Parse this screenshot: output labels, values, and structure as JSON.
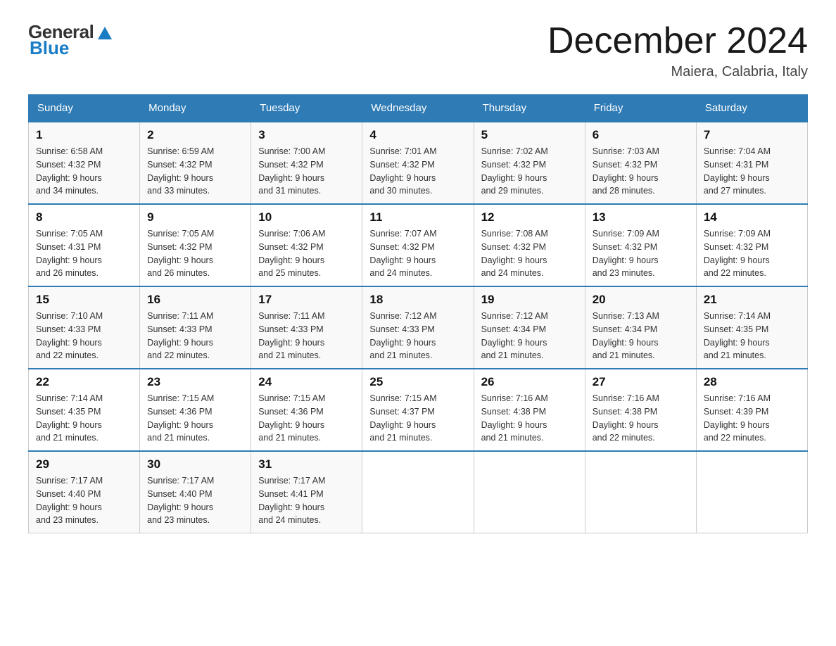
{
  "logo": {
    "text_general": "General",
    "text_blue": "Blue",
    "icon_shape": "triangle"
  },
  "title": "December 2024",
  "subtitle": "Maiera, Calabria, Italy",
  "days_of_week": [
    "Sunday",
    "Monday",
    "Tuesday",
    "Wednesday",
    "Thursday",
    "Friday",
    "Saturday"
  ],
  "weeks": [
    [
      {
        "day": "1",
        "sunrise": "6:58 AM",
        "sunset": "4:32 PM",
        "daylight": "9 hours and 34 minutes."
      },
      {
        "day": "2",
        "sunrise": "6:59 AM",
        "sunset": "4:32 PM",
        "daylight": "9 hours and 33 minutes."
      },
      {
        "day": "3",
        "sunrise": "7:00 AM",
        "sunset": "4:32 PM",
        "daylight": "9 hours and 31 minutes."
      },
      {
        "day": "4",
        "sunrise": "7:01 AM",
        "sunset": "4:32 PM",
        "daylight": "9 hours and 30 minutes."
      },
      {
        "day": "5",
        "sunrise": "7:02 AM",
        "sunset": "4:32 PM",
        "daylight": "9 hours and 29 minutes."
      },
      {
        "day": "6",
        "sunrise": "7:03 AM",
        "sunset": "4:32 PM",
        "daylight": "9 hours and 28 minutes."
      },
      {
        "day": "7",
        "sunrise": "7:04 AM",
        "sunset": "4:31 PM",
        "daylight": "9 hours and 27 minutes."
      }
    ],
    [
      {
        "day": "8",
        "sunrise": "7:05 AM",
        "sunset": "4:31 PM",
        "daylight": "9 hours and 26 minutes."
      },
      {
        "day": "9",
        "sunrise": "7:05 AM",
        "sunset": "4:32 PM",
        "daylight": "9 hours and 26 minutes."
      },
      {
        "day": "10",
        "sunrise": "7:06 AM",
        "sunset": "4:32 PM",
        "daylight": "9 hours and 25 minutes."
      },
      {
        "day": "11",
        "sunrise": "7:07 AM",
        "sunset": "4:32 PM",
        "daylight": "9 hours and 24 minutes."
      },
      {
        "day": "12",
        "sunrise": "7:08 AM",
        "sunset": "4:32 PM",
        "daylight": "9 hours and 24 minutes."
      },
      {
        "day": "13",
        "sunrise": "7:09 AM",
        "sunset": "4:32 PM",
        "daylight": "9 hours and 23 minutes."
      },
      {
        "day": "14",
        "sunrise": "7:09 AM",
        "sunset": "4:32 PM",
        "daylight": "9 hours and 22 minutes."
      }
    ],
    [
      {
        "day": "15",
        "sunrise": "7:10 AM",
        "sunset": "4:33 PM",
        "daylight": "9 hours and 22 minutes."
      },
      {
        "day": "16",
        "sunrise": "7:11 AM",
        "sunset": "4:33 PM",
        "daylight": "9 hours and 22 minutes."
      },
      {
        "day": "17",
        "sunrise": "7:11 AM",
        "sunset": "4:33 PM",
        "daylight": "9 hours and 21 minutes."
      },
      {
        "day": "18",
        "sunrise": "7:12 AM",
        "sunset": "4:33 PM",
        "daylight": "9 hours and 21 minutes."
      },
      {
        "day": "19",
        "sunrise": "7:12 AM",
        "sunset": "4:34 PM",
        "daylight": "9 hours and 21 minutes."
      },
      {
        "day": "20",
        "sunrise": "7:13 AM",
        "sunset": "4:34 PM",
        "daylight": "9 hours and 21 minutes."
      },
      {
        "day": "21",
        "sunrise": "7:14 AM",
        "sunset": "4:35 PM",
        "daylight": "9 hours and 21 minutes."
      }
    ],
    [
      {
        "day": "22",
        "sunrise": "7:14 AM",
        "sunset": "4:35 PM",
        "daylight": "9 hours and 21 minutes."
      },
      {
        "day": "23",
        "sunrise": "7:15 AM",
        "sunset": "4:36 PM",
        "daylight": "9 hours and 21 minutes."
      },
      {
        "day": "24",
        "sunrise": "7:15 AM",
        "sunset": "4:36 PM",
        "daylight": "9 hours and 21 minutes."
      },
      {
        "day": "25",
        "sunrise": "7:15 AM",
        "sunset": "4:37 PM",
        "daylight": "9 hours and 21 minutes."
      },
      {
        "day": "26",
        "sunrise": "7:16 AM",
        "sunset": "4:38 PM",
        "daylight": "9 hours and 21 minutes."
      },
      {
        "day": "27",
        "sunrise": "7:16 AM",
        "sunset": "4:38 PM",
        "daylight": "9 hours and 22 minutes."
      },
      {
        "day": "28",
        "sunrise": "7:16 AM",
        "sunset": "4:39 PM",
        "daylight": "9 hours and 22 minutes."
      }
    ],
    [
      {
        "day": "29",
        "sunrise": "7:17 AM",
        "sunset": "4:40 PM",
        "daylight": "9 hours and 23 minutes."
      },
      {
        "day": "30",
        "sunrise": "7:17 AM",
        "sunset": "4:40 PM",
        "daylight": "9 hours and 23 minutes."
      },
      {
        "day": "31",
        "sunrise": "7:17 AM",
        "sunset": "4:41 PM",
        "daylight": "9 hours and 24 minutes."
      },
      null,
      null,
      null,
      null
    ]
  ]
}
